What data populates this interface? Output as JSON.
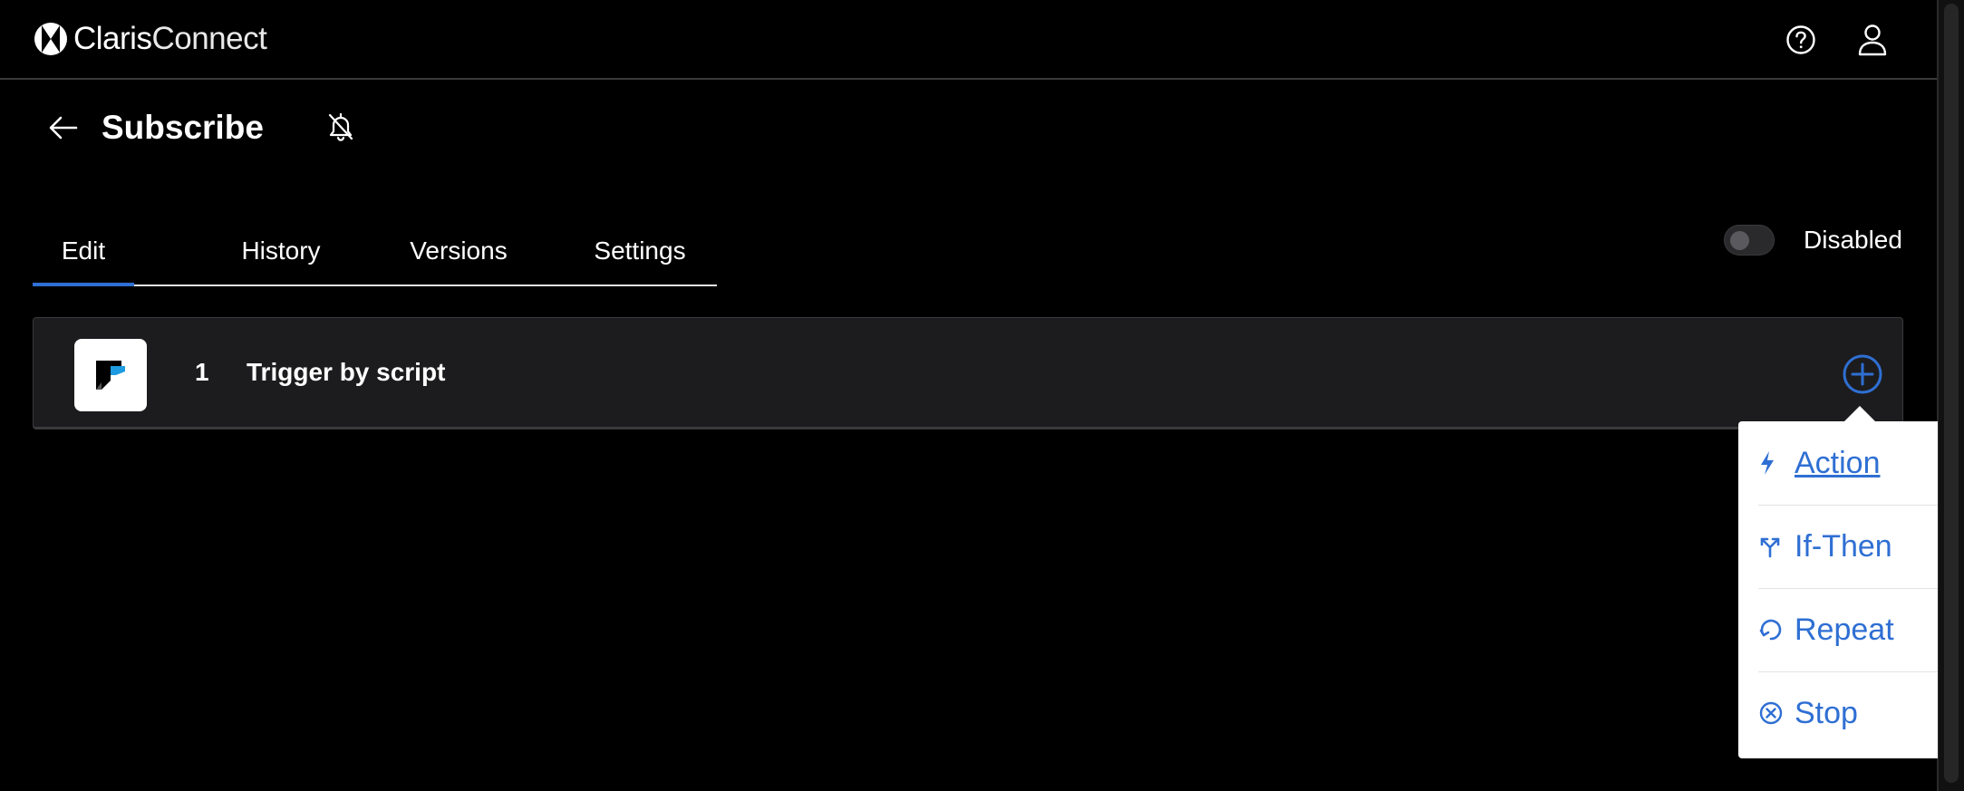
{
  "header": {
    "brand_primary": "Claris",
    "brand_secondary": "Connect",
    "help_icon": "question-circle-icon",
    "account_icon": "user-icon"
  },
  "page": {
    "back_icon": "arrow-left-icon",
    "title": "Subscribe",
    "notification_icon": "bell-off-icon"
  },
  "tabs": [
    {
      "label": "Edit",
      "active": true
    },
    {
      "label": "History",
      "active": false
    },
    {
      "label": "Versions",
      "active": false
    },
    {
      "label": "Settings",
      "active": false
    }
  ],
  "status_toggle": {
    "label": "Disabled",
    "enabled": false
  },
  "steps": [
    {
      "number": "1",
      "title": "Trigger by script",
      "app_icon": "filemaker-icon"
    }
  ],
  "add_step_menu": {
    "items": [
      {
        "label": "Action",
        "icon": "lightning-icon"
      },
      {
        "label": "If-Then",
        "icon": "branch-icon"
      },
      {
        "label": "Repeat",
        "icon": "repeat-icon"
      },
      {
        "label": "Stop",
        "icon": "stop-circle-icon"
      }
    ]
  },
  "colors": {
    "background": "#000000",
    "accent": "#2f6fd3",
    "card": "#1c1c1e"
  }
}
